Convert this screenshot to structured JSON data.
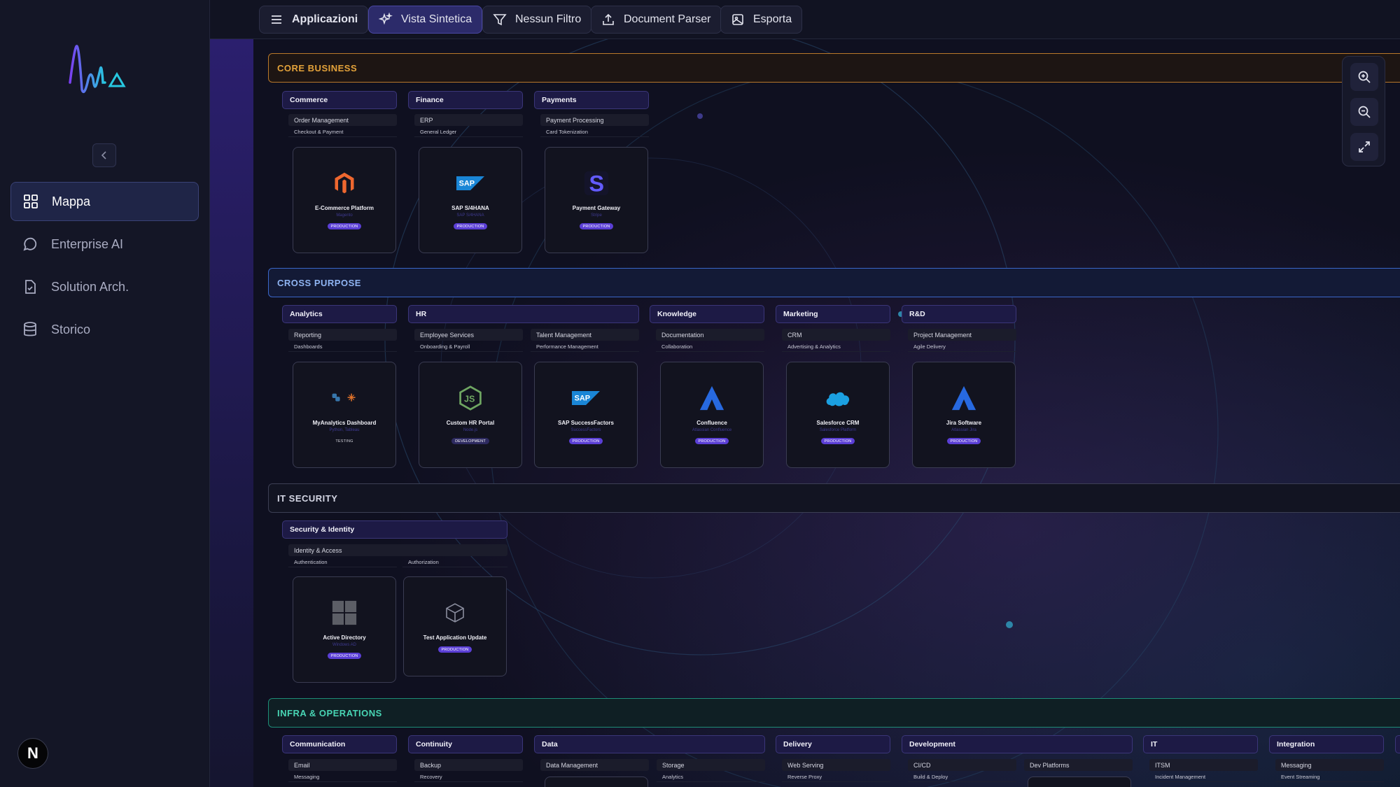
{
  "sidebar": {
    "nav": [
      {
        "label": "Mappa",
        "icon": "grid-icon",
        "active": true
      },
      {
        "label": "Enterprise AI",
        "icon": "chat-icon",
        "active": false
      },
      {
        "label": "Solution Arch.",
        "icon": "document-check-icon",
        "active": false
      },
      {
        "label": "Storico",
        "icon": "database-icon",
        "active": false
      }
    ],
    "avatar_letter": "N"
  },
  "toolbar": {
    "apps": "Applicazioni",
    "view": "Vista Sintetica",
    "filter": "Nessun Filtro",
    "parser": "Document Parser",
    "export": "Esporta"
  },
  "sections": {
    "core": "CORE BUSINESS",
    "cross": "CROSS PURPOSE",
    "security": "IT SECURITY",
    "infra": "INFRA & OPERATIONS"
  },
  "core": {
    "commerce": {
      "title": "Commerce",
      "cap": "Order Management",
      "sub": "Checkout & Payment"
    },
    "finance": {
      "title": "Finance",
      "cap": "ERP",
      "sub": "General Ledger"
    },
    "payments": {
      "title": "Payments",
      "cap": "Payment Processing",
      "sub": "Card Tokenization"
    },
    "cards": [
      {
        "name": "E-Commerce Platform",
        "sub": "Magento",
        "status": "PRODUCTION"
      },
      {
        "name": "SAP S/4HANA",
        "sub": "SAP S/4HANA",
        "status": "PRODUCTION"
      },
      {
        "name": "Payment Gateway",
        "sub": "Stripe",
        "status": "PRODUCTION"
      }
    ]
  },
  "cross": {
    "analytics": {
      "title": "Analytics",
      "cap": "Reporting",
      "sub": "Dashboards"
    },
    "hr": {
      "title": "HR",
      "cap1": "Employee Services",
      "sub1": "Onboarding & Payroll",
      "cap2": "Talent Management",
      "sub2": "Performance Management"
    },
    "knowledge": {
      "title": "Knowledge",
      "cap": "Documentation",
      "sub": "Collaboration"
    },
    "marketing": {
      "title": "Marketing",
      "cap": "CRM",
      "sub": "Advertising & Analytics"
    },
    "rnd": {
      "title": "R&D",
      "cap": "Project Management",
      "sub": "Agile Delivery"
    },
    "cards": [
      {
        "name": "MyAnalytics Dashboard",
        "sub": "Python, Tableau",
        "status": "TESTING"
      },
      {
        "name": "Custom HR Portal",
        "sub": "Node.js",
        "status": "DEVELOPMENT"
      },
      {
        "name": "SAP SuccessFactors",
        "sub": "SuccessFactors",
        "status": "PRODUCTION"
      },
      {
        "name": "Confluence",
        "sub": "Atlassian Confluence",
        "status": "PRODUCTION"
      },
      {
        "name": "Salesforce CRM",
        "sub": "Salesforce Platform",
        "status": "PRODUCTION"
      },
      {
        "name": "Jira Software",
        "sub": "Atlassian Jira",
        "status": "PRODUCTION"
      }
    ]
  },
  "security": {
    "group": {
      "title": "Security & Identity",
      "cap": "Identity & Access",
      "sub1": "Authentication",
      "sub2": "Authorization"
    },
    "cards": [
      {
        "name": "Active Directory",
        "sub": "Windows AD",
        "status": "PRODUCTION"
      },
      {
        "name": "Test Application Update",
        "sub": "",
        "status": "PRODUCTION"
      }
    ]
  },
  "infra": {
    "groups": [
      {
        "title": "Communication",
        "cap": "Email",
        "sub": "Messaging"
      },
      {
        "title": "Continuity",
        "cap": "Backup",
        "sub": "Recovery"
      },
      {
        "title": "Data",
        "cap1": "Data Management",
        "cap2": "Storage",
        "sub": "Analytics"
      },
      {
        "title": "Delivery",
        "cap": "Web Serving",
        "sub": "Reverse Proxy"
      },
      {
        "title": "Development",
        "cap1": "CI/CD",
        "sub": "Build & Deploy",
        "cap2": "Dev Platforms"
      },
      {
        "title": "IT",
        "cap": "ITSM",
        "sub": "Incident Management"
      },
      {
        "title": "Integration",
        "cap": "Messaging",
        "sub": "Event Streaming"
      }
    ]
  },
  "colors": {
    "accent": "#5b3fd6",
    "core": "#e3a23a",
    "cross": "#4f7ce0",
    "security": "#5a5d70",
    "infra": "#2fb59b"
  }
}
